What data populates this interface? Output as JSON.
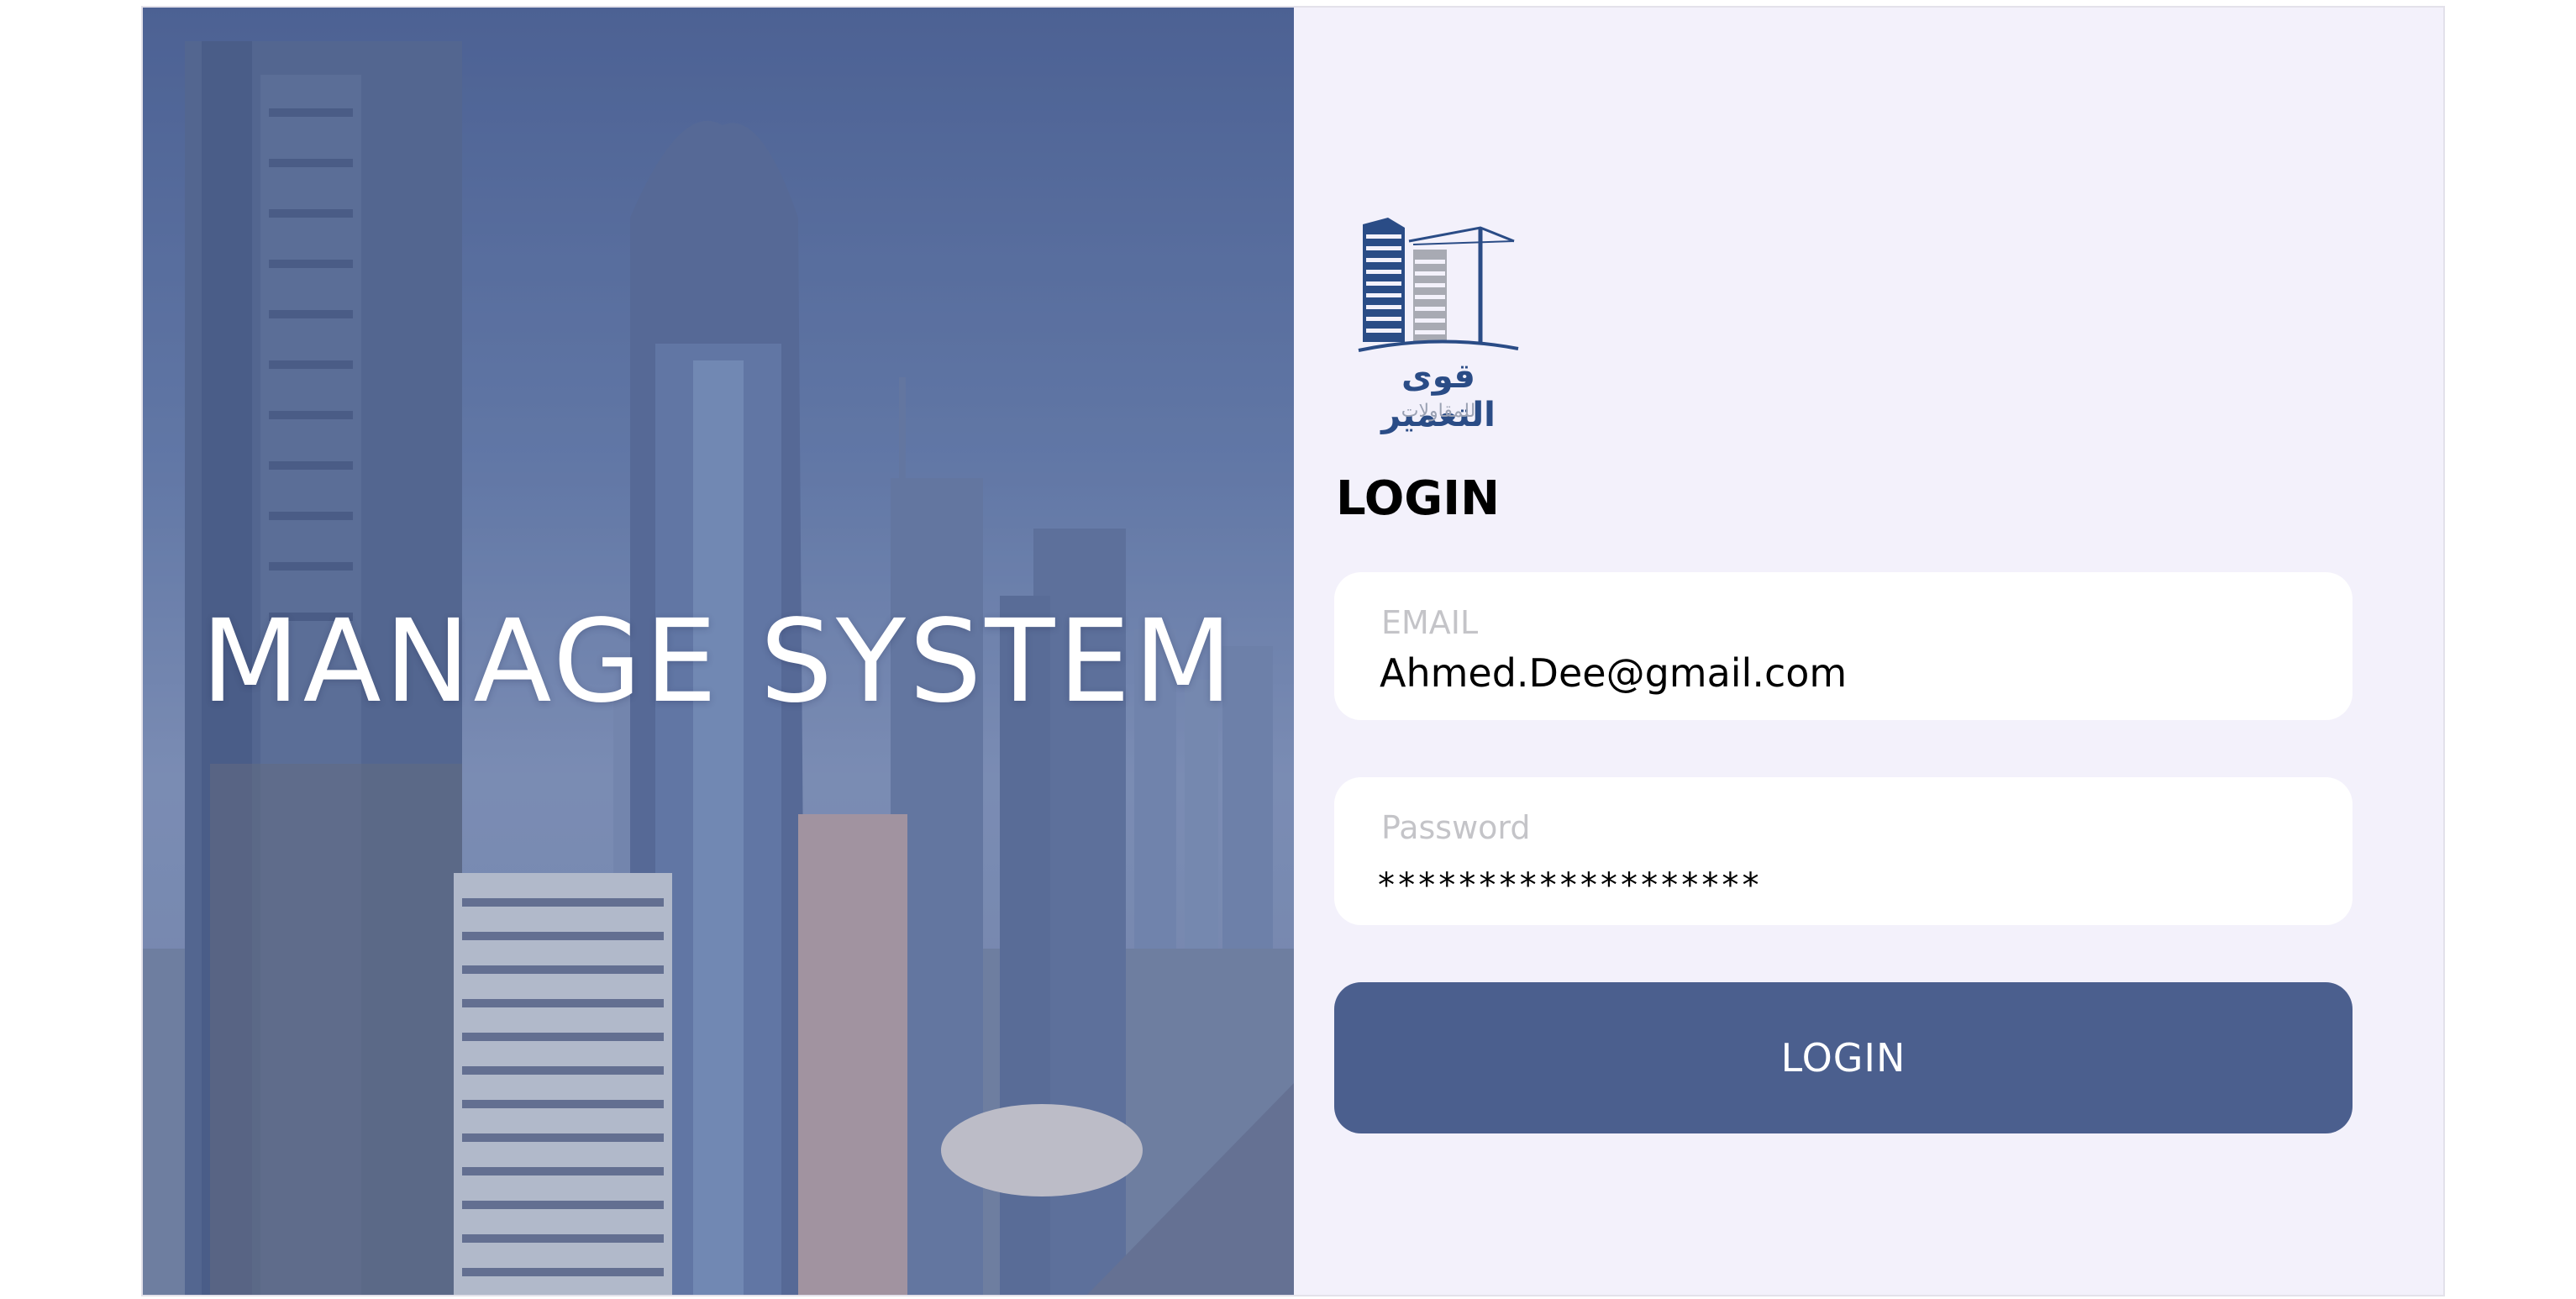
{
  "hero": {
    "title": "MANAGE SYSTEM"
  },
  "logo": {
    "name_ar": "قوى التعمير",
    "subtitle_ar": "للمقاولات"
  },
  "login": {
    "heading": "LOGIN",
    "email": {
      "label": "EMAIL",
      "value": "Ahmed.Dee@gmail.com"
    },
    "password": {
      "label": "Password",
      "masked_value": "*******************"
    },
    "button_label": "LOGIN"
  },
  "colors": {
    "brand_blue": "#4b5f8e",
    "panel_bg": "#f3f1fb",
    "logo_blue": "#2a4c86"
  }
}
